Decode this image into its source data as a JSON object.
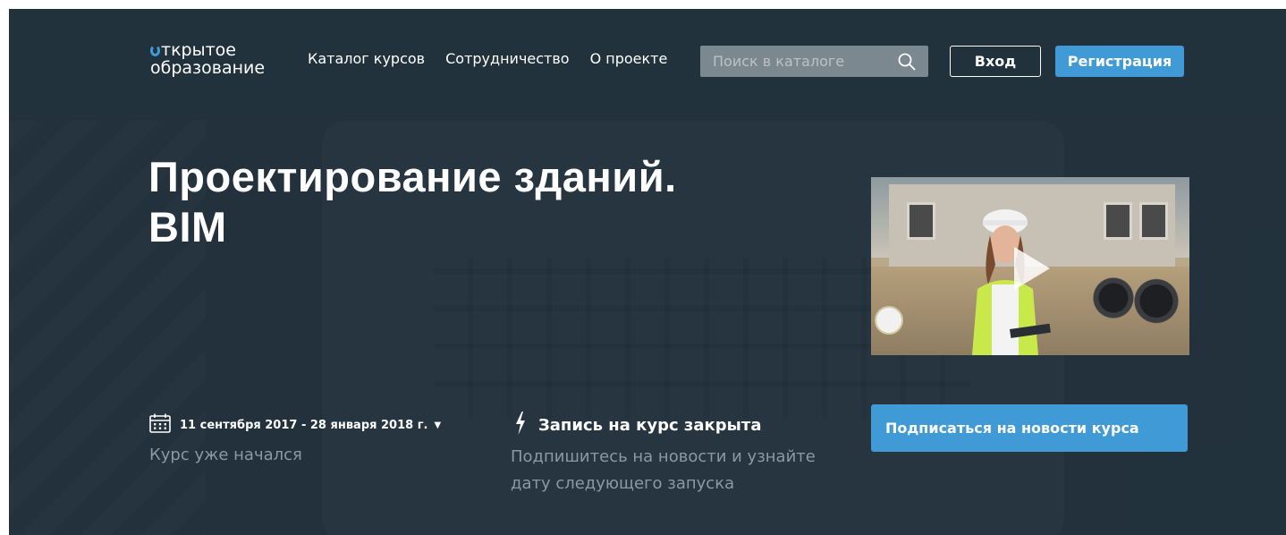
{
  "header": {
    "logo_line1": "ткрытое",
    "logo_line2": "образование",
    "nav": [
      "Каталог курсов",
      "Сотрудничество",
      "О проекте"
    ],
    "search_placeholder": "Поиск в каталоге",
    "login_label": "Вход",
    "register_label": "Регистрация"
  },
  "course": {
    "title_line1": "Проектирование зданий.",
    "title_line2": "BIM",
    "dates": "11 сентября 2017 - 28 января 2018 г.",
    "status": "Курс уже начался",
    "enrollment_title": "Запись на курс закрыта",
    "enrollment_note": "Подпишитесь на новости и узнайте дату следующего запуска",
    "subscribe_label": "Подписаться на новости курса"
  },
  "colors": {
    "background": "#22323d",
    "accent": "#3f9ad6",
    "muted_text": "#8c99a2"
  },
  "icons": [
    "search-icon",
    "calendar-icon",
    "lightning-icon",
    "chevron-down-icon",
    "play-icon"
  ]
}
